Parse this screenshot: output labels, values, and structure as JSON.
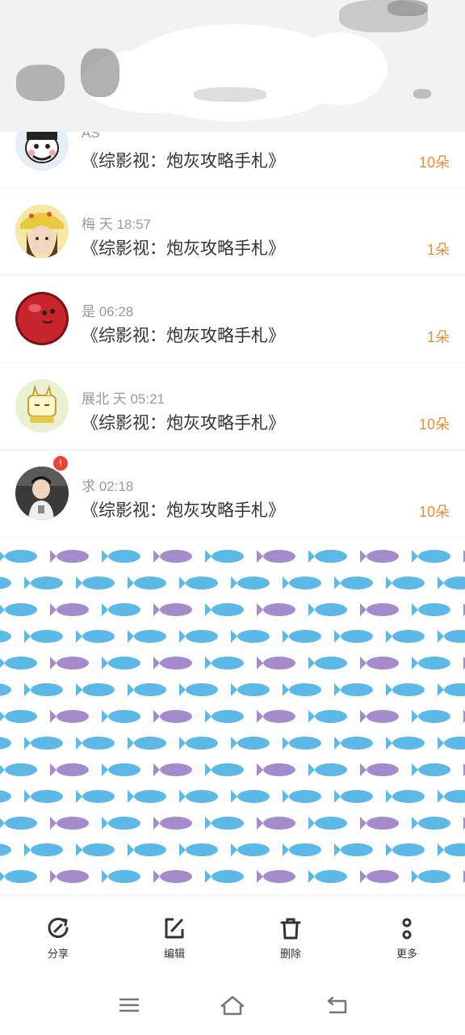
{
  "items": [
    {
      "meta": "AS",
      "title": "《综影视：炮灰攻略手札》",
      "count": "10朵"
    },
    {
      "meta": "梅 天 18:57",
      "title": "《综影视：炮灰攻略手札》",
      "count": "1朵"
    },
    {
      "meta": "是 06:28",
      "title": "《综影视：炮灰攻略手札》",
      "count": "1朵"
    },
    {
      "meta": "展北 天 05:21",
      "title": "《综影视：炮灰攻略手札》",
      "count": "10朵"
    },
    {
      "meta": "求 02:18",
      "title": "《综影视：炮灰攻略手札》",
      "count": "10朵",
      "badge": "!"
    }
  ],
  "toolbar": {
    "share": "分享",
    "edit": "编辑",
    "delete": "删除",
    "more": "更多"
  },
  "icons": {
    "share": "share-icon",
    "edit": "edit-icon",
    "delete": "trash-icon",
    "more": "more-vertical-icon",
    "nav_menu": "menu-icon",
    "nav_home": "home-icon",
    "nav_back": "back-icon"
  },
  "colors": {
    "accent": "#f08a34",
    "fish_blue": "#5cb8e6",
    "fish_purple": "#a48bcc",
    "badge": "#e8423c"
  }
}
